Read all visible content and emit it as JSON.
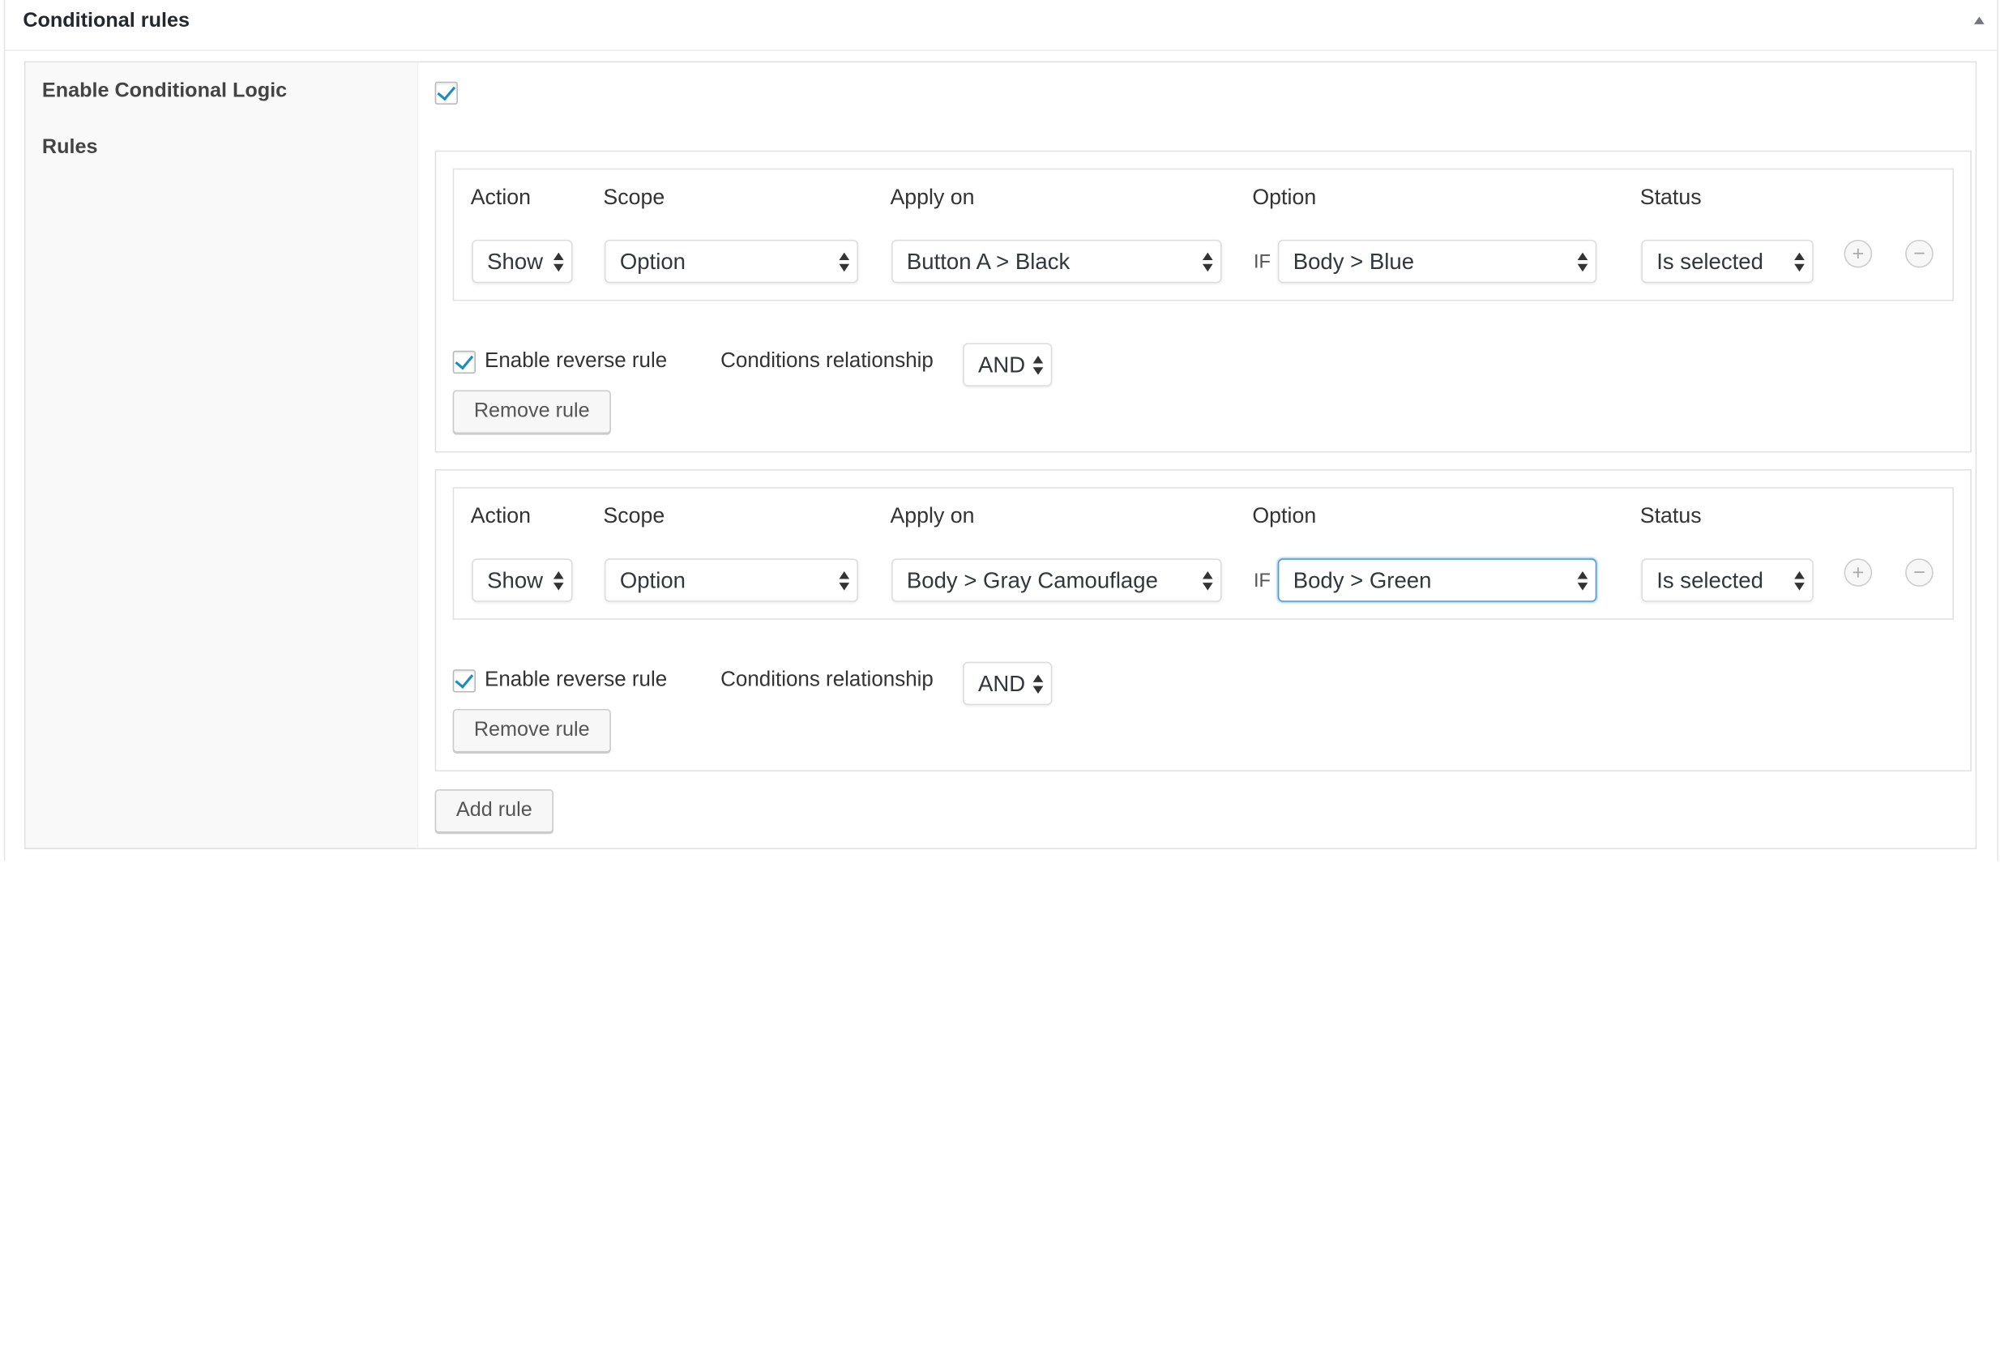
{
  "panel": {
    "title": "Conditional rules"
  },
  "form": {
    "enable_label": "Enable Conditional Logic",
    "enable_checked": true,
    "rules_label": "Rules"
  },
  "columns": {
    "action": "Action",
    "scope": "Scope",
    "apply_on": "Apply on",
    "option": "Option",
    "status": "Status"
  },
  "if_label": "IF",
  "rules": [
    {
      "action": "Show",
      "scope": "Option",
      "apply_on": "Button A > Black",
      "option": "Body > Blue",
      "status": "Is selected",
      "enable_reverse_label": "Enable reverse rule",
      "enable_reverse_checked": true,
      "relationship_label": "Conditions relationship",
      "relationship": "AND",
      "remove_label": "Remove rule"
    },
    {
      "action": "Show",
      "scope": "Option",
      "apply_on": "Body > Gray Camouflage",
      "option": "Body > Green",
      "status": "Is selected",
      "enable_reverse_label": "Enable reverse rule",
      "enable_reverse_checked": true,
      "relationship_label": "Conditions relationship",
      "relationship": "AND",
      "remove_label": "Remove rule"
    }
  ],
  "add_rule_label": "Add rule",
  "icons": {
    "add": "+",
    "remove": "−"
  },
  "colors": {
    "check": "#1e8cbe",
    "focus_border": "#5b9dd9",
    "label_bg": "#f9f9f9"
  }
}
